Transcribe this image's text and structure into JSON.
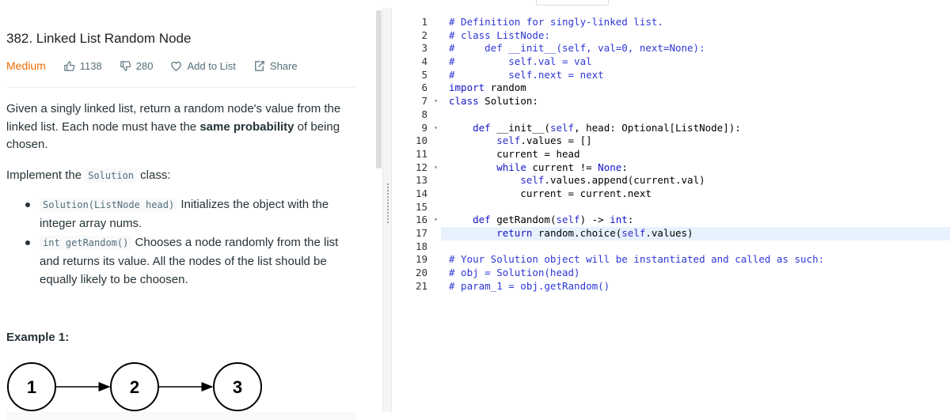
{
  "problem": {
    "title": "382. Linked List Random Node",
    "difficulty": "Medium",
    "likes": "1138",
    "dislikes": "280",
    "add_to_list": "Add to List",
    "share": "Share",
    "description_part1": "Given a singly linked list, return a random node's value from the linked list. Each node must have the ",
    "description_bold": "same probability",
    "description_part2": " of being chosen.",
    "impl_before": "Implement the ",
    "impl_code": "Solution",
    "impl_after": " class:",
    "bullets": [
      {
        "code": "Solution(ListNode head)",
        "text": " Initializes the object with the integer array nums."
      },
      {
        "code": "int getRandom()",
        "text": " Chooses a node randomly from the list and returns its value. All the nodes of the list should be equally likely to be choosen."
      }
    ],
    "example_label": "Example 1:",
    "diagram_nodes": [
      "1",
      "2",
      "3"
    ]
  },
  "editor": {
    "line_numbers": [
      "1",
      "2",
      "3",
      "4",
      "5",
      "6",
      "7",
      "8",
      "9",
      "10",
      "11",
      "12",
      "13",
      "14",
      "15",
      "16",
      "17",
      "18",
      "19",
      "20",
      "21"
    ],
    "folds": [
      "",
      "",
      "",
      "",
      "",
      "",
      "▾",
      "",
      "▾",
      "",
      "",
      "▾",
      "",
      "",
      "",
      "▾",
      "",
      "",
      "",
      "",
      ""
    ],
    "lines": [
      "# Definition for singly-linked list.",
      "# class ListNode:",
      "#     def __init__(self, val=0, next=None):",
      "#         self.val = val",
      "#         self.next = next",
      "import random",
      "class Solution:",
      "",
      "    def __init__(self, head: Optional[ListNode]):",
      "        self.values = []",
      "        current = head",
      "        while current != None:",
      "            self.values.append(current.val)",
      "            current = current.next",
      "",
      "    def getRandom(self) -> int:",
      "        return random.choice(self.values)",
      "",
      "# Your Solution object will be instantiated and called as such:",
      "# obj = Solution(head)",
      "# param_1 = obj.getRandom()"
    ],
    "active_line": 17
  },
  "colors": {
    "difficulty": "#ef6c00",
    "comment": "#2e37d6",
    "active_line_bg": "#e8f2fe"
  }
}
